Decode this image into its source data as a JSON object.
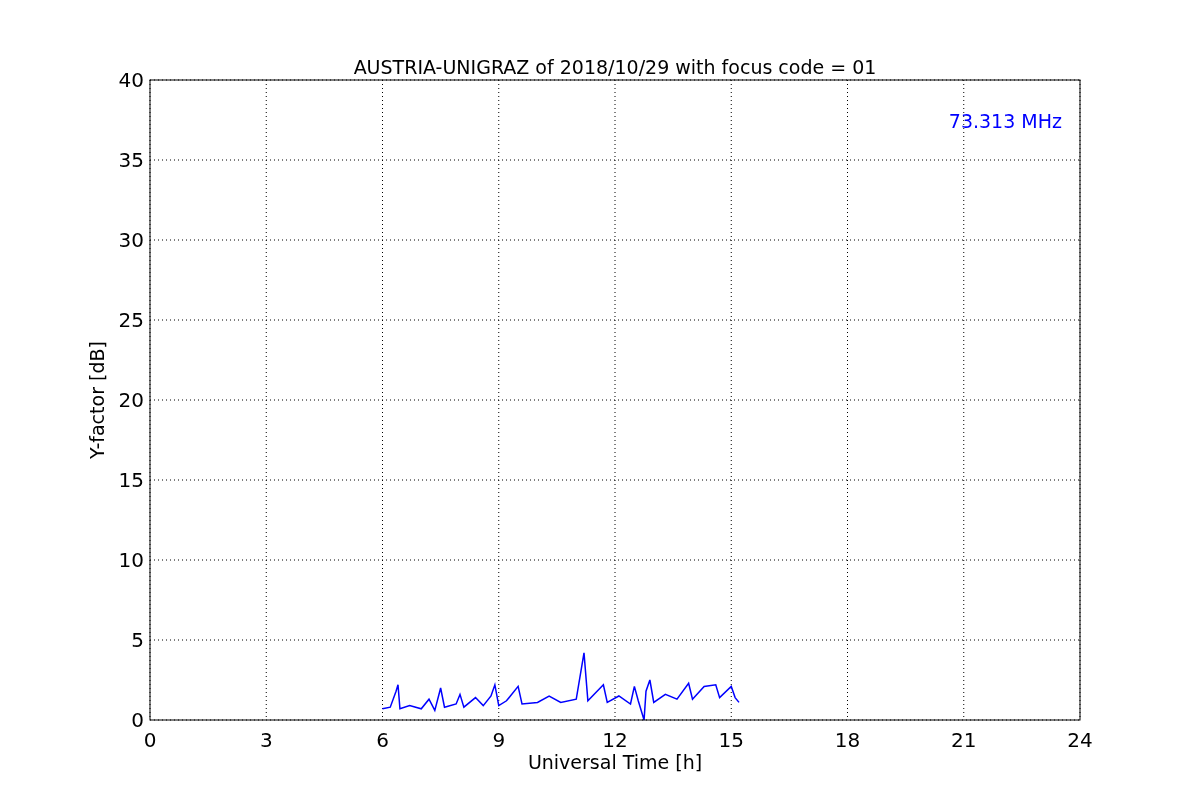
{
  "chart_data": {
    "type": "line",
    "title": "AUSTRIA-UNIGRAZ of 2018/10/29 with focus code = 01",
    "xlabel": "Universal Time [h]",
    "ylabel": "Y-factor [dB]",
    "xlim": [
      0,
      24
    ],
    "ylim": [
      0,
      40
    ],
    "xticks": [
      0,
      3,
      6,
      9,
      12,
      15,
      18,
      21,
      24
    ],
    "yticks": [
      0,
      5,
      10,
      15,
      20,
      25,
      30,
      35,
      40
    ],
    "x": [
      6.0,
      6.2,
      6.35,
      6.4,
      6.45,
      6.7,
      7.0,
      7.2,
      7.35,
      7.5,
      7.6,
      7.9,
      8.0,
      8.1,
      8.4,
      8.6,
      8.8,
      8.9,
      9.0,
      9.2,
      9.5,
      9.6,
      10.0,
      10.3,
      10.6,
      11.0,
      11.2,
      11.3,
      11.7,
      11.8,
      12.1,
      12.4,
      12.5,
      12.6,
      12.75,
      12.8,
      12.9,
      13.0,
      13.3,
      13.6,
      13.9,
      14.0,
      14.3,
      14.6,
      14.7,
      15.0,
      15.1,
      15.2
    ],
    "series": [
      {
        "name": "73.313 MHz",
        "color": "#0000ff",
        "values": [
          0.7,
          0.8,
          1.8,
          2.2,
          0.7,
          0.9,
          0.7,
          1.3,
          0.6,
          2.0,
          0.8,
          1.0,
          1.6,
          0.8,
          1.4,
          0.9,
          1.5,
          2.2,
          0.9,
          1.2,
          2.1,
          1.0,
          1.1,
          1.5,
          1.1,
          1.3,
          4.2,
          1.2,
          2.2,
          1.1,
          1.5,
          1.0,
          2.1,
          1.2,
          0.0,
          1.8,
          2.5,
          1.1,
          1.6,
          1.3,
          2.3,
          1.3,
          2.1,
          2.2,
          1.4,
          2.1,
          1.4,
          1.1
        ]
      }
    ],
    "grid": true
  }
}
